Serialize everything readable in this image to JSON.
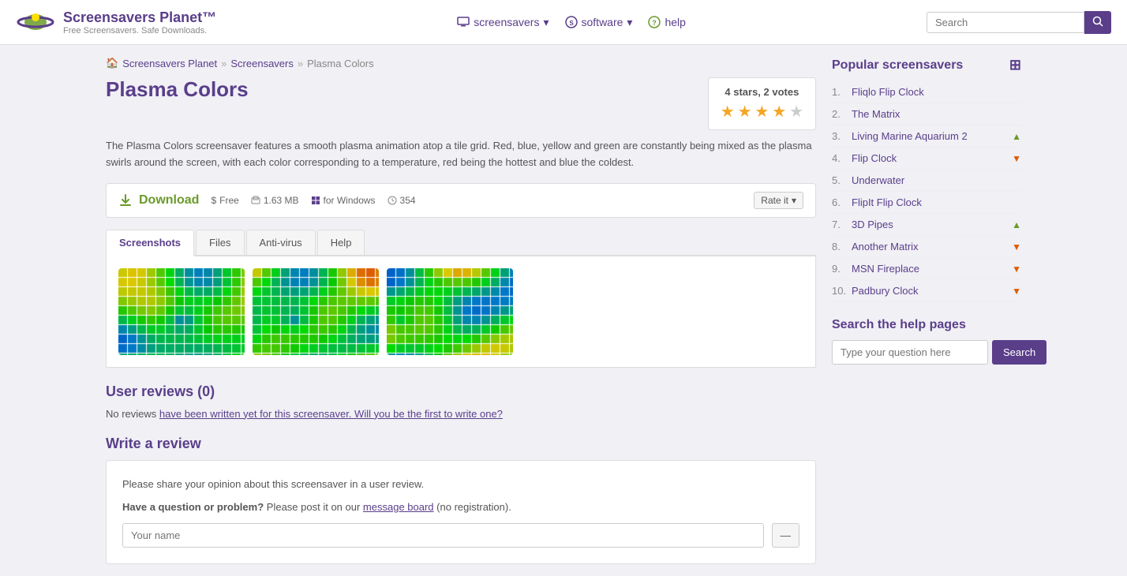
{
  "header": {
    "logo_title": "Screensavers Planet™",
    "logo_subtitle": "Free Screensavers. Safe Downloads.",
    "nav": [
      {
        "id": "screensavers",
        "label": "screensavers",
        "icon": "monitor",
        "has_dropdown": true
      },
      {
        "id": "software",
        "label": "software",
        "icon": "circle-s",
        "has_dropdown": true
      },
      {
        "id": "help",
        "label": "help",
        "icon": "circle-q",
        "has_dropdown": false
      }
    ],
    "search_placeholder": "Search"
  },
  "breadcrumb": {
    "items": [
      {
        "label": "Screensavers Planet",
        "href": "#"
      },
      {
        "label": "Screensavers",
        "href": "#"
      },
      {
        "label": "Plasma Colors",
        "href": null
      }
    ]
  },
  "page": {
    "title": "Plasma Colors",
    "description": "The Plasma Colors screensaver features a smooth plasma animation atop a tile grid. Red, blue, yellow and green are constantly being mixed as the plasma swirls around the screen, with each color corresponding to a temperature, red being the hottest and blue the coldest.",
    "rating_text": "4 stars, 2 votes",
    "stars_filled": 4,
    "stars_empty": 1,
    "download": {
      "label": "Download",
      "price": "Free",
      "size": "1.63 MB",
      "platform": "for Windows",
      "count": "354",
      "rate_label": "Rate it"
    },
    "tabs": [
      {
        "id": "screenshots",
        "label": "Screenshots",
        "active": true
      },
      {
        "id": "files",
        "label": "Files",
        "active": false
      },
      {
        "id": "antivirus",
        "label": "Anti-virus",
        "active": false
      },
      {
        "id": "help",
        "label": "Help",
        "active": false
      }
    ],
    "user_reviews": {
      "title": "User reviews (0)",
      "no_reviews_text": "No reviews have been written yet for this screensaver. Will you be the first to write one?"
    },
    "write_review": {
      "title": "Write a review",
      "intro": "Please share your opinion about this screensaver in a user review.",
      "question": "Have a question or problem?",
      "question_text": " Please post it on our ",
      "board_link": "message board",
      "board_suffix": " (no registration).",
      "name_placeholder": "Your name",
      "name_btn_label": "—"
    }
  },
  "sidebar": {
    "popular_title": "Popular screensavers",
    "popular_items": [
      {
        "rank": 1,
        "label": "Fliqlo Flip Clock",
        "trend": "none"
      },
      {
        "rank": 2,
        "label": "The Matrix",
        "trend": "none"
      },
      {
        "rank": 3,
        "label": "Living Marine Aquarium 2",
        "trend": "up"
      },
      {
        "rank": 4,
        "label": "Flip Clock",
        "trend": "down"
      },
      {
        "rank": 5,
        "label": "Underwater",
        "trend": "none"
      },
      {
        "rank": 6,
        "label": "FlipIt Flip Clock",
        "trend": "none"
      },
      {
        "rank": 7,
        "label": "3D Pipes",
        "trend": "up"
      },
      {
        "rank": 8,
        "label": "Another Matrix",
        "trend": "down"
      },
      {
        "rank": 9,
        "label": "MSN Fireplace",
        "trend": "down"
      },
      {
        "rank": 10,
        "label": "Padbury Clock",
        "trend": "down"
      }
    ],
    "help_search_title": "Search the help pages",
    "help_search_placeholder": "Type your question here",
    "help_search_btn": "Search"
  }
}
